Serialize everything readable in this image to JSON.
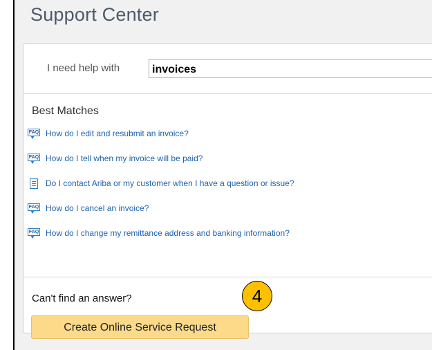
{
  "page": {
    "title": "Support Center"
  },
  "search": {
    "label": "I need help with",
    "value": "invoices"
  },
  "matches": {
    "heading": "Best Matches",
    "items": [
      {
        "icon": "faq-icon",
        "text": "How do I edit and resubmit an invoice?"
      },
      {
        "icon": "faq-icon",
        "text": "How do I tell when my invoice will be paid?"
      },
      {
        "icon": "document-icon",
        "text": "Do I contact Ariba or my customer when I have a question or issue?"
      },
      {
        "icon": "faq-icon",
        "text": "How do I cancel an invoice?"
      },
      {
        "icon": "faq-icon",
        "text": "How do I change my remittance address and banking information?"
      }
    ]
  },
  "footer": {
    "prompt": "Can't find an answer?",
    "button_label": "Create Online Service Request"
  },
  "annotation": {
    "step_number": "4",
    "badge_color": "#ffc000"
  },
  "colors": {
    "link": "#1f62b0",
    "button": "#fdd98a"
  },
  "faq_icon_text": "FAQ"
}
